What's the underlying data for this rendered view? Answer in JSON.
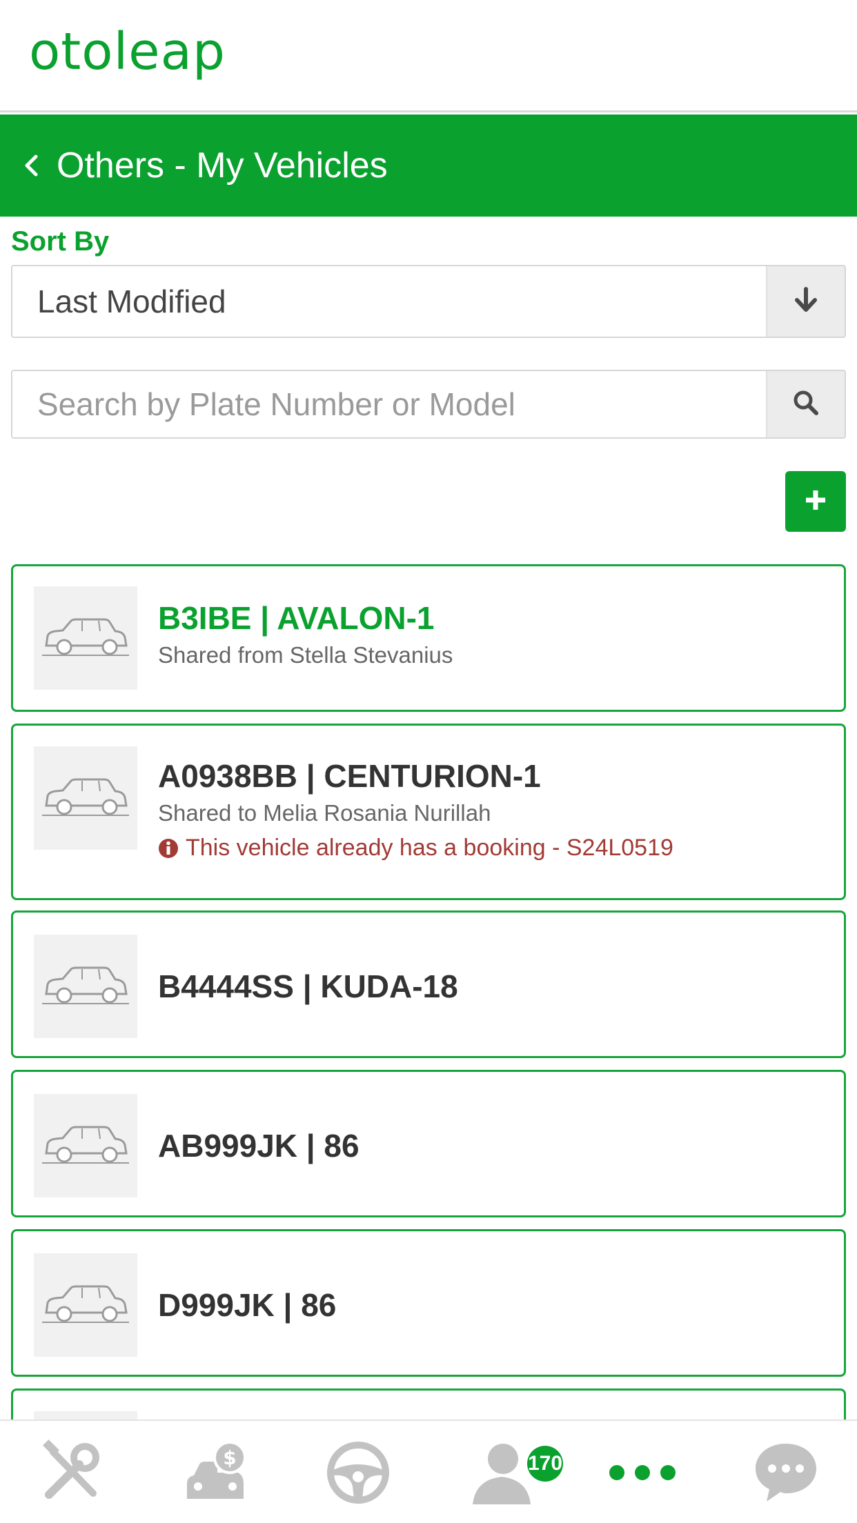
{
  "app": {
    "logo_text": "otoleap",
    "brand_color": "#0aa12f"
  },
  "header": {
    "back_icon": "chevron-left-icon",
    "title": "Others - My Vehicles"
  },
  "sort": {
    "label": "Sort By",
    "selected": "Last Modified",
    "icon": "arrow-down-icon"
  },
  "search": {
    "placeholder": "Search by Plate Number or Model",
    "value": "",
    "icon": "search-icon"
  },
  "add_button": {
    "icon": "plus-icon"
  },
  "vehicles": [
    {
      "plate": "B3IBE | AVALON-1",
      "subtitle": "Shared from Stella Stevanius",
      "warning": "",
      "highlight": true
    },
    {
      "plate": "A0938BB | CENTURION-1",
      "subtitle": "Shared to Melia Rosania Nurillah",
      "warning": "This vehicle already has a booking - S24L0519",
      "highlight": false
    },
    {
      "plate": "B4444SS | KUDA-18",
      "subtitle": "",
      "warning": "",
      "highlight": false
    },
    {
      "plate": "AB999JK | 86",
      "subtitle": "",
      "warning": "",
      "highlight": false
    },
    {
      "plate": "D999JK | 86",
      "subtitle": "",
      "warning": "",
      "highlight": false
    }
  ],
  "colors": {
    "warning": "#a23a35",
    "card_border": "#16a53a",
    "nav_icon": "#c2c2c2"
  },
  "bottom_nav": {
    "items": [
      "tools-icon",
      "car-finance-icon",
      "steering-wheel-icon",
      "profile-icon",
      "more-icon",
      "chat-icon"
    ],
    "badge": "170"
  }
}
